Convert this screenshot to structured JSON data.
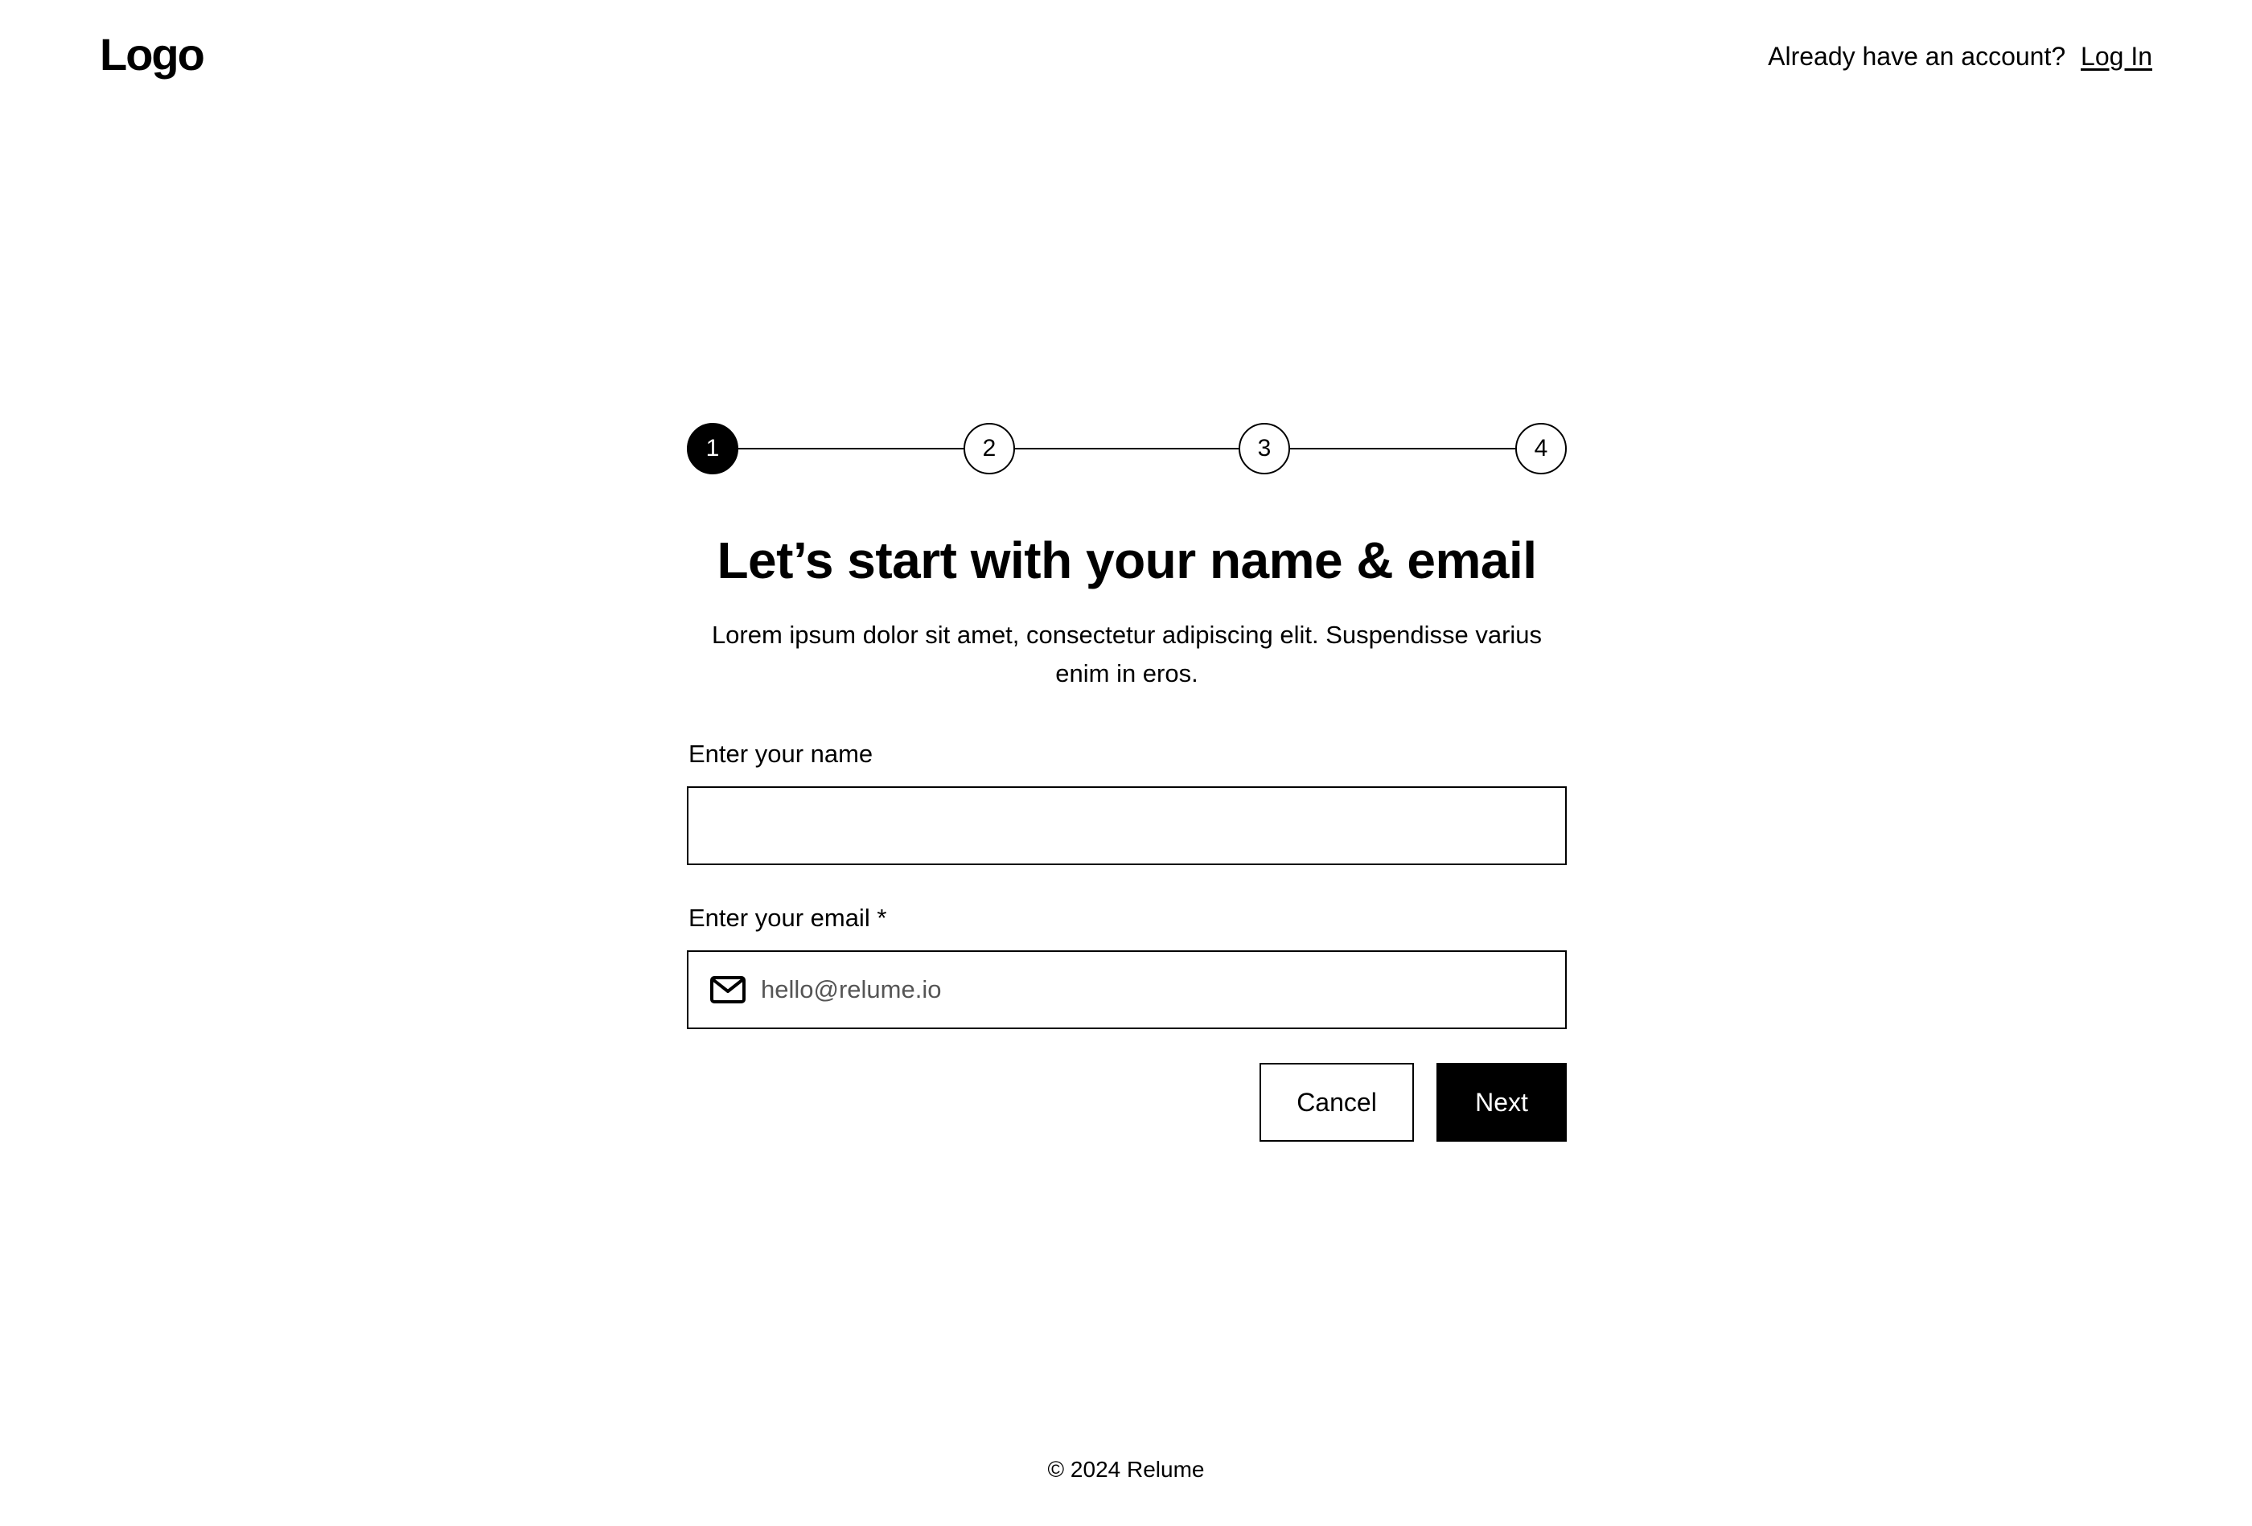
{
  "header": {
    "logo": "Logo",
    "login_prompt": "Already have an account?",
    "login_link": "Log In"
  },
  "stepper": {
    "steps": [
      "1",
      "2",
      "3",
      "4"
    ],
    "current_step": 1
  },
  "form": {
    "title": "Let’s start with your name & email",
    "subtitle": "Lorem ipsum dolor sit amet, consectetur adipiscing elit. Suspendisse varius enim in eros.",
    "name_label": "Enter your name",
    "name_value": "",
    "email_label": "Enter your email *",
    "email_placeholder": "hello@relume.io",
    "email_icon": "mail-icon",
    "cancel_label": "Cancel",
    "next_label": "Next"
  },
  "footer": {
    "copyright": "© 2024 Relume"
  },
  "colors": {
    "primary": "#000000",
    "background": "#ffffff",
    "placeholder": "#555555"
  }
}
